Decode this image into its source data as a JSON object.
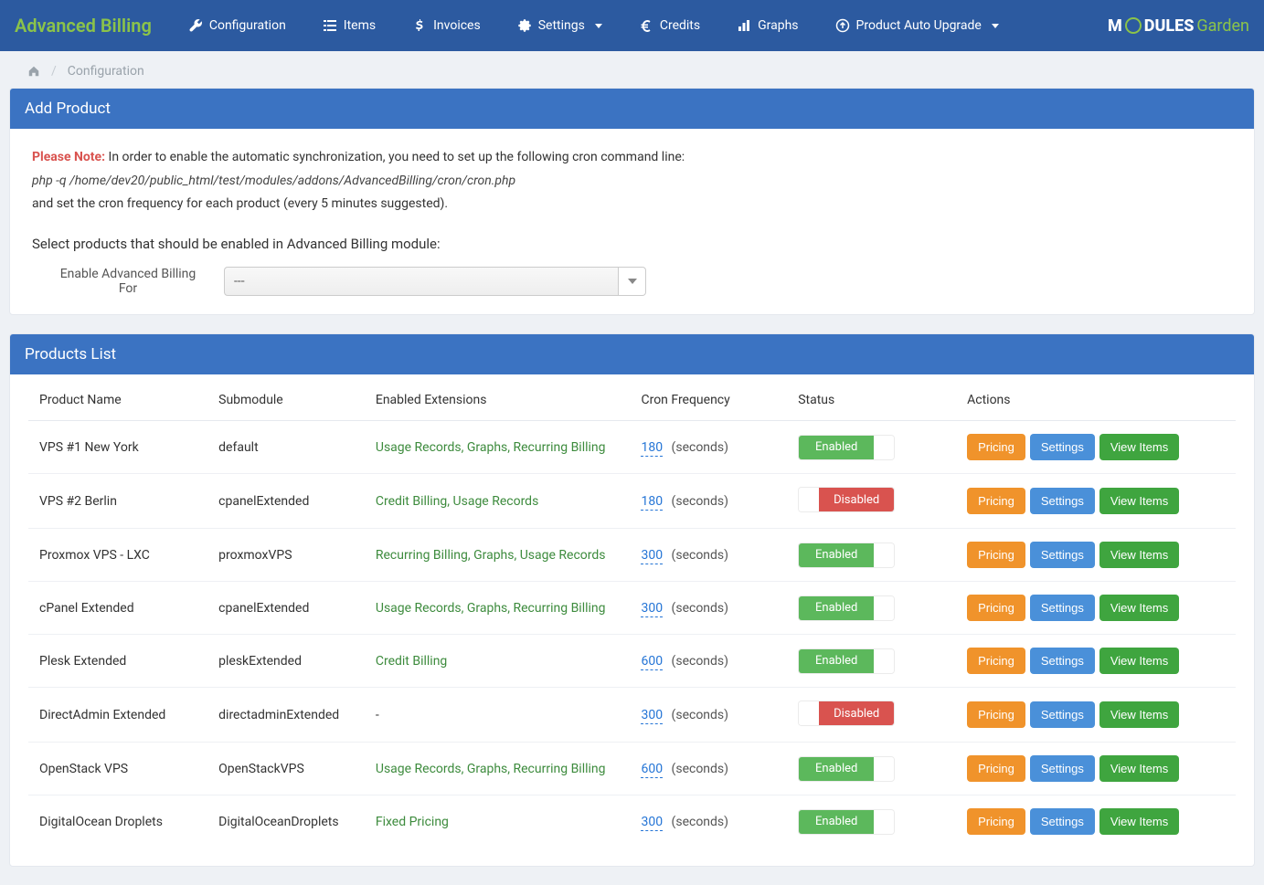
{
  "brand": "Advanced Billing",
  "nav": {
    "configuration": "Configuration",
    "items": "Items",
    "invoices": "Invoices",
    "settings": "Settings",
    "credits": "Credits",
    "graphs": "Graphs",
    "autoUpgrade": "Product Auto Upgrade"
  },
  "logo": {
    "left": "M",
    "mid": "DULES",
    "right": "Garden"
  },
  "breadcrumb": {
    "current": "Configuration"
  },
  "addProduct": {
    "title": "Add Product",
    "noteLabel": "Please Note:",
    "noteText": "In order to enable the automatic synchronization, you need to set up the following cron command line:",
    "cronCmd": "php -q /home/dev20/public_html/test/modules/addons/AdvancedBilling/cron/cron.php",
    "noteText2": "and set the cron frequency for each product (every 5 minutes suggested).",
    "selectPrompt": "Select products that should be enabled in Advanced Billing module:",
    "enableLabel": "Enable Advanced Billing For",
    "dropdownValue": "---"
  },
  "productsList": {
    "title": "Products List",
    "headers": {
      "name": "Product Name",
      "submodule": "Submodule",
      "extensions": "Enabled Extensions",
      "cron": "Cron Frequency",
      "status": "Status",
      "actions": "Actions"
    },
    "cronUnit": "(seconds)",
    "statusLabels": {
      "enabled": "Enabled",
      "disabled": "Disabled"
    },
    "actionLabels": {
      "pricing": "Pricing",
      "settings": "Settings",
      "viewItems": "View Items"
    },
    "rows": [
      {
        "name": "VPS #1 New York",
        "submodule": "default",
        "extensions": "Usage Records, Graphs, Recurring Billing",
        "cron": "180",
        "status": "enabled"
      },
      {
        "name": "VPS #2 Berlin",
        "submodule": "cpanelExtended",
        "extensions": "Credit Billing, Usage Records",
        "cron": "180",
        "status": "disabled"
      },
      {
        "name": "Proxmox VPS - LXC",
        "submodule": "proxmoxVPS",
        "extensions": "Recurring Billing, Graphs, Usage Records",
        "cron": "300",
        "status": "enabled"
      },
      {
        "name": "cPanel Extended",
        "submodule": "cpanelExtended",
        "extensions": "Usage Records, Graphs, Recurring Billing",
        "cron": "300",
        "status": "enabled"
      },
      {
        "name": "Plesk Extended",
        "submodule": "pleskExtended",
        "extensions": "Credit Billing",
        "cron": "600",
        "status": "enabled"
      },
      {
        "name": "DirectAdmin Extended",
        "submodule": "directadminExtended",
        "extensions": "-",
        "cron": "300",
        "status": "disabled"
      },
      {
        "name": "OpenStack VPS",
        "submodule": "OpenStackVPS",
        "extensions": "Usage Records, Graphs, Recurring Billing",
        "cron": "600",
        "status": "enabled"
      },
      {
        "name": "DigitalOcean Droplets",
        "submodule": "DigitalOceanDroplets",
        "extensions": "Fixed Pricing",
        "cron": "300",
        "status": "enabled"
      }
    ]
  }
}
